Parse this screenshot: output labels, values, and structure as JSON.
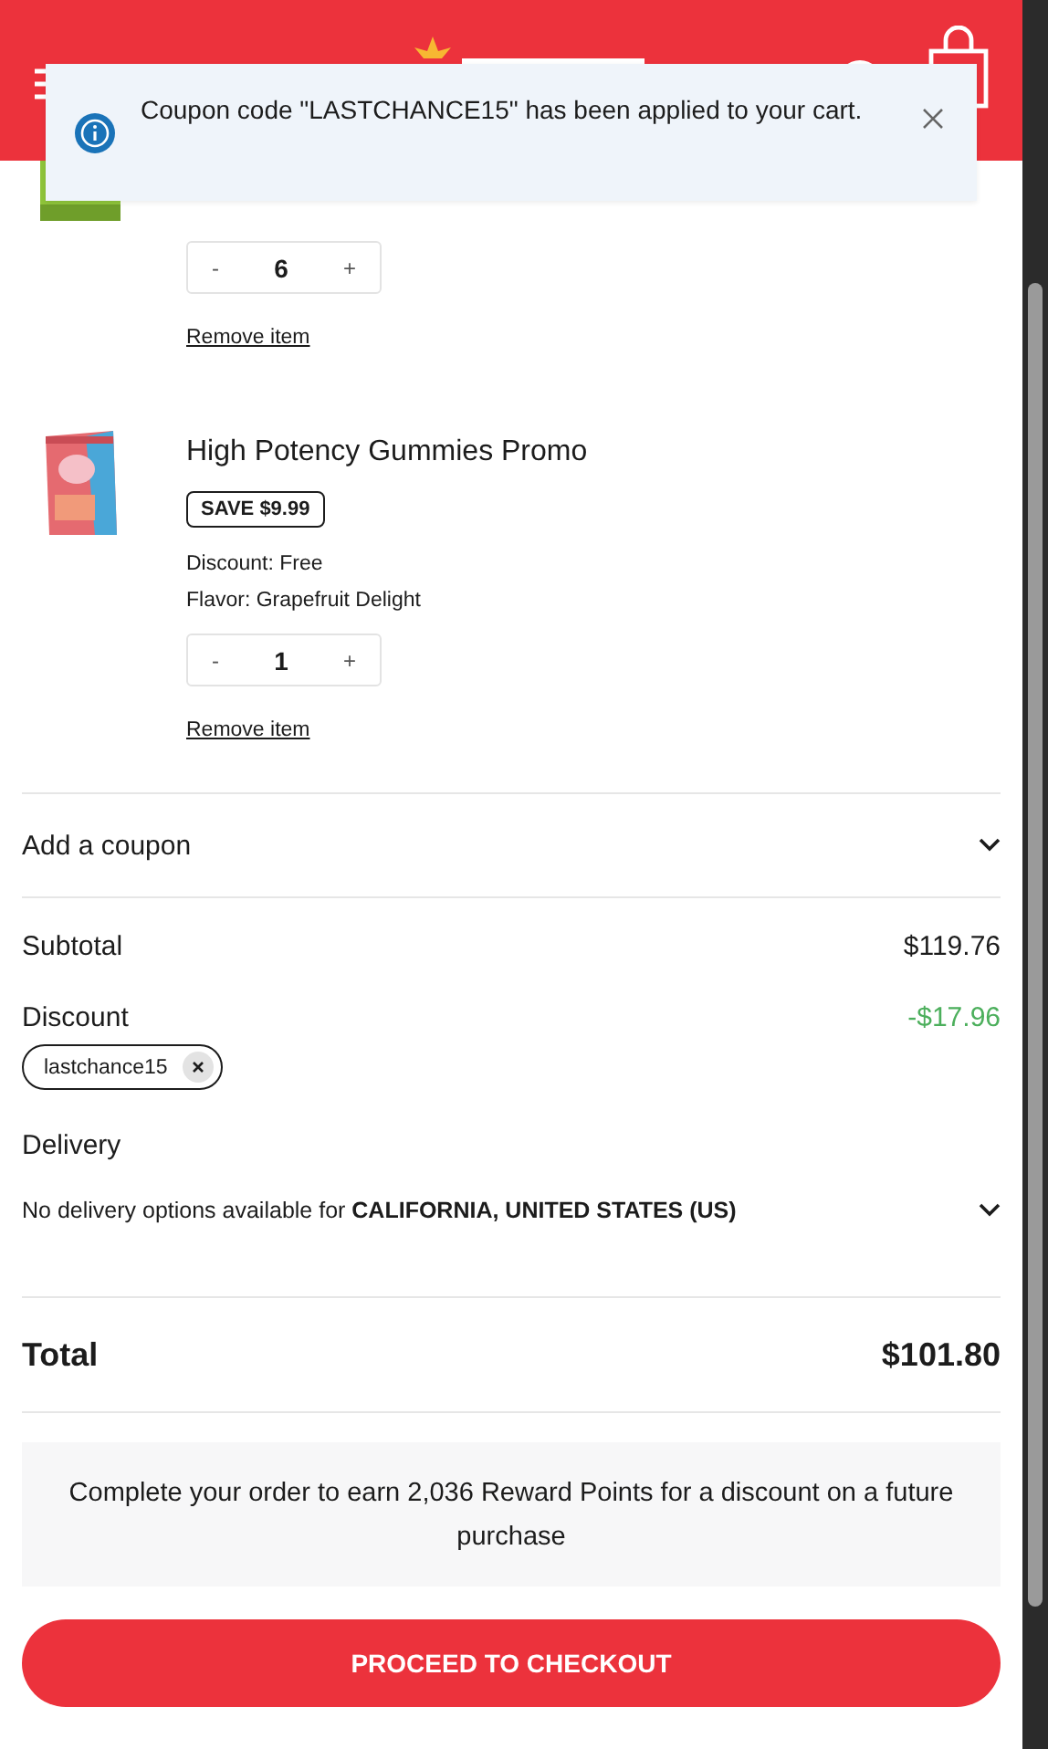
{
  "toast": {
    "message": "Coupon code \"LASTCHANCE15\" has been applied to your cart."
  },
  "items": [
    {
      "kind": "cut",
      "quantity": "6",
      "decrease": "-",
      "increase": "+",
      "remove": "Remove item"
    },
    {
      "kind": "full",
      "name": "High Potency Gummies Promo",
      "badge": "SAVE $9.99",
      "details": [
        "Discount: Free",
        "Flavor: Grapefruit Delight"
      ],
      "quantity": "1",
      "decrease": "-",
      "increase": "+",
      "remove": "Remove item"
    }
  ],
  "coupon": {
    "label": "Add a coupon"
  },
  "subtotal": {
    "label": "Subtotal",
    "value": "$119.76"
  },
  "discount": {
    "label": "Discount",
    "value": "-$17.96",
    "code": "lastchance15"
  },
  "delivery": {
    "label": "Delivery",
    "message": "No delivery options available for **CALIFORNIA, UNITED STATES (US)**"
  },
  "total": {
    "label": "Total",
    "value": "$101.80"
  },
  "rewards": "Complete your order to earn 2,036 Reward Points for a discount on a future purchase",
  "checkout": "PROCEED TO CHECKOUT"
}
